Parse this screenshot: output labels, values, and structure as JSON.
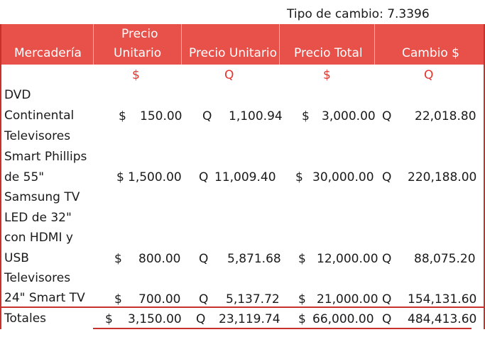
{
  "exchange_rate": "Tipo de cambio: 7.3396",
  "headers": {
    "mercaderia": "Mercadería",
    "precio_unitario_usd_1": "Precio",
    "precio_unitario_usd_2": "Unitario",
    "precio_unitario_q": "Precio Unitario",
    "precio_total": "Precio Total",
    "cambio": "Cambio $"
  },
  "currency_row": {
    "col1": "$",
    "col2": "Q",
    "col3": "$",
    "col4": "Q"
  },
  "rows": [
    {
      "name_lines": [
        "DVD",
        "Continental",
        "Televisores"
      ],
      "unit_usd_sym": "$",
      "unit_usd": "150.00",
      "unit_q_sym": "Q",
      "unit_q": "1,100.94",
      "total_usd_sym": "$",
      "total_usd": "3,000.00",
      "total_q_sym": "Q",
      "total_q": "22,018.80"
    },
    {
      "name_lines": [
        "Smart Phillips",
        "de 55\""
      ],
      "unit_usd_sym": "$",
      "unit_usd": "1,500.00",
      "unit_q_sym": "Q",
      "unit_q": "11,009.40",
      "total_usd_sym": "$",
      "total_usd": "30,000.00",
      "total_q_sym": "Q",
      "total_q": "220,188.00"
    },
    {
      "name_lines": [
        "Samsung TV",
        "LED de 32\"",
        "con HDMI y",
        "USB"
      ],
      "unit_usd_sym": "$",
      "unit_usd": "800.00",
      "unit_q_sym": "Q",
      "unit_q": "5,871.68",
      "total_usd_sym": "$",
      "total_usd": "12,000.00",
      "total_q_sym": "Q",
      "total_q": "88,075.20"
    },
    {
      "name_lines": [
        "Televisores",
        "24\" Smart TV"
      ],
      "unit_usd_sym": "$",
      "unit_usd": "700.00",
      "unit_q_sym": "Q",
      "unit_q": "5,137.72",
      "total_usd_sym": "$",
      "total_usd": "21,000.00",
      "total_q_sym": "Q",
      "total_q": "154,131.60"
    }
  ],
  "totals": {
    "label": "Totales",
    "unit_usd_sym": "$",
    "unit_usd": "3,150.00",
    "unit_q_sym": "Q",
    "unit_q": "23,119.74",
    "total_usd_sym": "$",
    "total_usd": "66,000.00",
    "total_q_sym": "Q",
    "total_q": "484,413.60"
  }
}
